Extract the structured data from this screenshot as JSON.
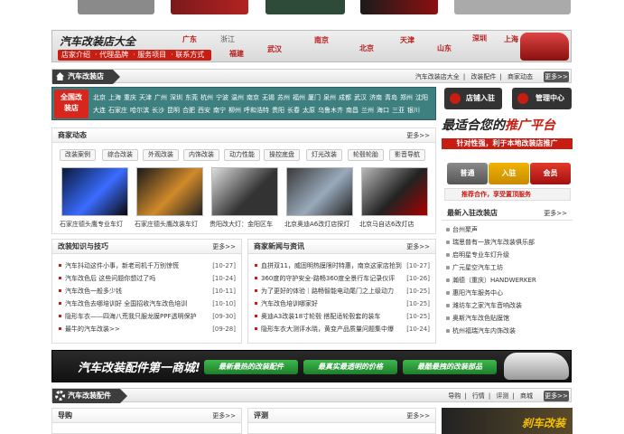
{
  "banner": {
    "title": "汽车改装店大全",
    "nav": [
      "店家介绍",
      "代理品牌",
      "服务项目",
      "联系方式"
    ],
    "cities": [
      {
        "name": "广东",
        "hl": true
      },
      {
        "name": "浙江",
        "hl": false
      },
      {
        "name": "福建",
        "hl": true
      },
      {
        "name": "武汉",
        "hl": true
      },
      {
        "name": "南京",
        "hl": true
      },
      {
        "name": "北京",
        "hl": true
      },
      {
        "name": "天津",
        "hl": true
      },
      {
        "name": "山东",
        "hl": true
      },
      {
        "name": "深圳",
        "hl": true
      },
      {
        "name": "上海",
        "hl": true
      }
    ]
  },
  "stores_section": {
    "title": "汽车改装店",
    "links": [
      "汽车改装店大全",
      "改装配件",
      "商家动态"
    ],
    "more": "更多>>"
  },
  "citybox": {
    "label_top": "全国改",
    "label_bottom": "装店",
    "items": [
      "北京",
      "上海",
      "重庆",
      "天津",
      "广州",
      "深圳",
      "东莞",
      "杭州",
      "宁波",
      "温州",
      "南京",
      "无锡",
      "苏州",
      "福州",
      "厦门",
      "泉州",
      "成都",
      "武汉",
      "济南",
      "青岛",
      "郑州",
      "沈阳",
      "大连",
      "石家庄",
      "哈尔滨",
      "长沙",
      "昆明",
      "合肥",
      "西安",
      "南宁",
      "柳州",
      "呼和浩特",
      "贵阳",
      "长春",
      "太原",
      "乌鲁木齐",
      "南昌",
      "兰州",
      "海口",
      "三亚",
      "银川"
    ]
  },
  "right_buttons": [
    "店铺入驻",
    "管理中心"
  ],
  "news": {
    "title": "商家动态",
    "more": "更多>>",
    "tags": [
      "改装案例",
      "综合改装",
      "外观改装",
      "内饰改装",
      "动力性能",
      "操控底盘",
      "灯光改装",
      "轮毂轮胎",
      "影音导航"
    ],
    "thumbs": [
      {
        "caption": "石家庄德头鹰专业车灯"
      },
      {
        "caption": "石家庄德头鹰改装车灯"
      },
      {
        "caption": "贵阳改大灯：金阳区车"
      },
      {
        "caption": "北京奥迪A6改灯店探灯"
      },
      {
        "caption": "北京马自达6改灯店"
      }
    ]
  },
  "tips": {
    "title": "改装知识与技巧",
    "more": "更多>>",
    "items": [
      {
        "text": "汽车抖动这件小事，新老司机千万别惊慌",
        "date": "[10-27]"
      },
      {
        "text": "汽车改色后 这些问题你想过了吗",
        "date": "[10-24]"
      },
      {
        "text": "汽车改色一般多少钱",
        "date": "[10-11]"
      },
      {
        "text": "汽车改色去哪培训好 全国招收汽车改色培训",
        "date": "[10-10]"
      },
      {
        "text": "隐形车衣——四海八荒我只服龙膜PPF透明保护",
        "date": "[09-30]"
      },
      {
        "text": "最牛的汽车改装>>",
        "date": "[09-28]"
      }
    ]
  },
  "news2": {
    "title": "商家新闻与资讯",
    "more": "更多>>",
    "items": [
      {
        "text": "血拼双11，威固明热膜限时特惠，南京这家店抢到",
        "date": "[10-27]"
      },
      {
        "text": "360度的守护安全-路畅360度全景行车记录仪评",
        "date": "[10-26]"
      },
      {
        "text": "为了更好的体验｜路畅智能电动尾门之上级动力",
        "date": "[10-25]"
      },
      {
        "text": "汽车改色培训哪家好",
        "date": "[10-25]"
      },
      {
        "text": "奥迪A3改装18寸轮毂 搭配适轮毂套的装车",
        "date": "[10-25]"
      },
      {
        "text": "隐形车衣大测评水晓，黄变产品质量问题集中爆",
        "date": "[10-24]"
      }
    ]
  },
  "promo": {
    "lead": "最适合您的",
    "highlight": "推广平台",
    "sub": "针对性强，利于本地改装店推广",
    "levels": [
      "普通",
      "入驻",
      "会员"
    ],
    "bar": "推荐合作，享受置顶服务"
  },
  "latest": {
    "title": "最新入驻改装店",
    "more": "更多>>",
    "items": [
      "台州聚声",
      "瑞思普有一族汽车改装俱乐部",
      "启明星专业车灯升级",
      "广元星空汽车工坊",
      "瀚德（重庆）HANDWERKER",
      "惠阳汽车服务中心",
      "潍坊车之家汽车音响改装",
      "奥斯汽车改色贴膜馆",
      "杭州福瑞汽车内饰改装"
    ]
  },
  "adbar": {
    "title": "汽车改装配件第一商城!",
    "pills": [
      "最新最热的改装配件",
      "最真实最透明的价格",
      "最酷最拽的改装部品"
    ]
  },
  "parts_section": {
    "title": "汽车改装配件",
    "links": [
      "导购",
      "行情",
      "评测",
      "商城"
    ],
    "more": "更多>>"
  },
  "bottom": {
    "left_title": "导购",
    "right_title": "评测",
    "more": "更多>>",
    "ad_text": "刹车改装"
  },
  "colors": {
    "accent": "#c71d12",
    "dark": "#3d3d3d",
    "teal": "#3e7f7f"
  }
}
